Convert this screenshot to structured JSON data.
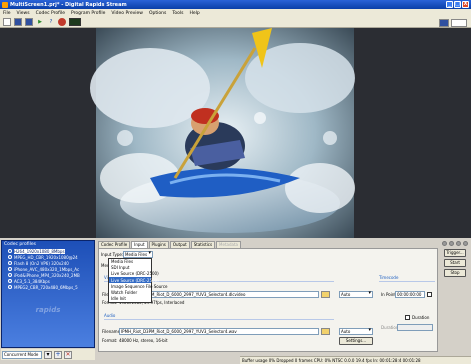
{
  "window": {
    "title": "MultiScreen1.prj* - Digital Rapids Stream",
    "buttons": [
      "_",
      "□",
      "X"
    ]
  },
  "menu": [
    "File",
    "Views",
    "Codec Profile",
    "Program Profile",
    "Video Preview",
    "Options",
    "Tools",
    "Help"
  ],
  "toolbar": {
    "help_label": "?"
  },
  "codec_profiles": {
    "title": "Codec profiles",
    "items": [
      "H264_1920x1080_8Mbps",
      "MPEG_HD_CBR_1920x1080@24",
      "Flash 8 (On2 VP6) 320x240",
      "iPhone_AVC_480x320_1Mbps_Ac",
      "iPod&iPhone_MP4_320x240_2MB",
      "AC3_5.1_384Kbps",
      "MPEG2_CBR_720x480_6Mbps_5"
    ],
    "selected_index": 0,
    "watermark": "rapids"
  },
  "mode_bar": {
    "mode": "Concurrent Mode",
    "add": "+",
    "remove": "✕"
  },
  "tabs": [
    "Codec Profile",
    "Input",
    "Plugins",
    "Output",
    "Statistics",
    "Metadata"
  ],
  "active_tab": 1,
  "input": {
    "type_label": "Input Type:",
    "type_value": "Media Files",
    "media_label": "Media",
    "dropdown_options": [
      "Media Files",
      "SDI Input",
      "Live Source (DRC-2500)",
      "Live Source (DRC-2500)",
      "Image Sequence File Source",
      "Watch Folder",
      "Idle Init"
    ],
    "dropdown_highlight": 3
  },
  "video": {
    "group": "Video",
    "filename_label": "Filename:",
    "filename": "IPMH_Riot_D3PM_Riot_D_6000_2997_YUV3_Selector4.dlcvideo",
    "format_label": "Format:",
    "format": "1920x1080, 29.97fps, Interlaced",
    "auto": "Auto"
  },
  "audio": {
    "group": "Audio",
    "filename_label": "Filename:",
    "filename": "IPMH_Riot_D3PM_Riot_D_6000_2997_YUV3_Selector4.wav",
    "format_label": "Format:",
    "format": "48000 Hz, stereo, 16-bit",
    "auto": "Auto",
    "settings": "Settings..."
  },
  "timecode": {
    "group": "Timecode",
    "in_point_label": "In Point:",
    "in_point": "00:00:00:00",
    "duration_label": "Duration",
    "duration_field_label": "Duration:"
  },
  "actions": {
    "trigger": "Trigger...",
    "start": "Start",
    "stop": "Stop"
  },
  "status": {
    "text": "Buffer usage 0%  Dropped 0 frames  CPU: 0%  NTSC 0.0.0  19.4 fps  In: 00:01:28:4  00:01:28"
  },
  "colors": {
    "accent": "#0a3fa8",
    "panel": "#d4d0c8",
    "highlight": "#316ac5",
    "kayak_yellow": "#f0c419"
  }
}
